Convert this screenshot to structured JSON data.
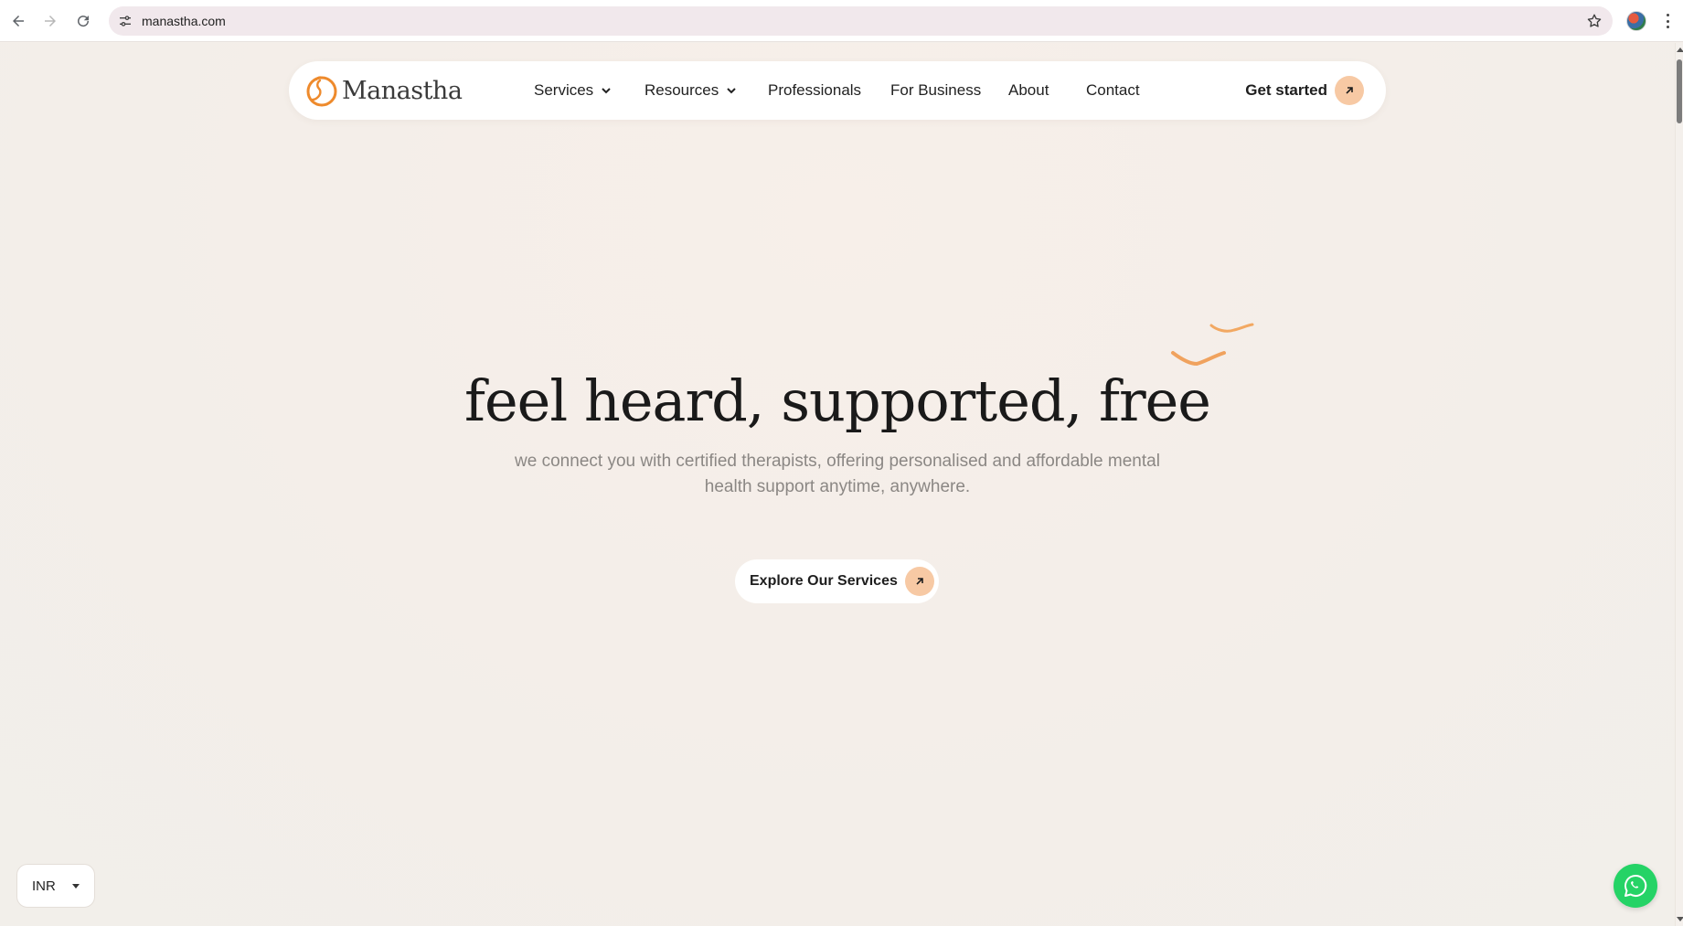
{
  "browser": {
    "url": "manastha.com",
    "icons": [
      "back-icon",
      "forward-icon",
      "reload-icon",
      "site-settings-icon",
      "bookmark-star-icon",
      "profile-avatar",
      "more-menu-icon"
    ]
  },
  "header": {
    "logo_text": "Manastha",
    "nav": {
      "services": "Services",
      "resources": "Resources",
      "professionals": "Professionals",
      "for_business": "For Business",
      "about": "About",
      "contact": "Contact"
    },
    "cta": "Get started"
  },
  "hero": {
    "title": "feel heard, supported, free",
    "subtitle_line1": "we connect you with certified therapists, offering personalised and affordable mental",
    "subtitle_line2": "health support anytime, anywhere.",
    "button": "Explore Our Services"
  },
  "currency": {
    "selected": "INR"
  },
  "colors": {
    "accent": "#f0a25e",
    "accent_soft": "#f7c9a4",
    "background": "#f4efea",
    "whatsapp": "#25d366"
  }
}
